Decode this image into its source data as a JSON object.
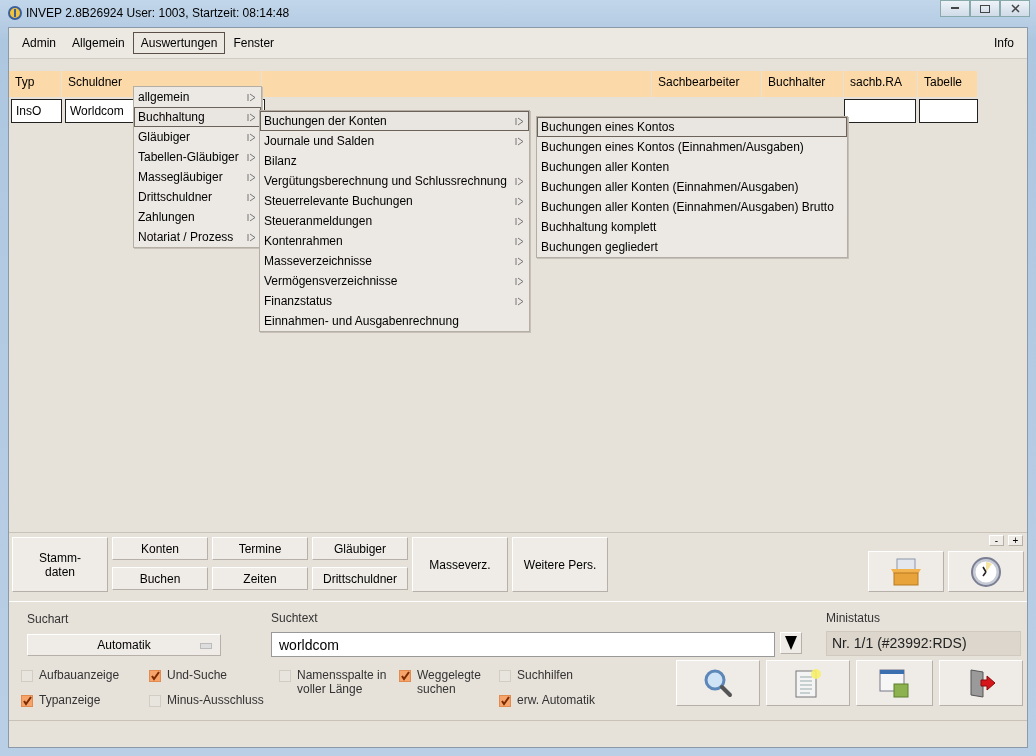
{
  "window": {
    "title": "INVEP 2.8B26924 User: 1003, Startzeit: 08:14:48"
  },
  "menubar": {
    "items": [
      {
        "label": "Admin",
        "selected": false
      },
      {
        "label": "Allgemein",
        "selected": false
      },
      {
        "label": "Auswertungen",
        "selected": true
      },
      {
        "label": "Fenster",
        "selected": false
      }
    ],
    "info": "Info"
  },
  "table": {
    "columns_left": [
      "Typ",
      "Schuldner"
    ],
    "columns_right": [
      "Sachbearbeiter",
      "Buchhalter",
      "sachb.RA",
      "Tabelle"
    ],
    "row": {
      "typ": "InsO",
      "schuldner": "Worldcom"
    }
  },
  "menus": [
    {
      "items": [
        {
          "label": "allgemein",
          "submenu": true,
          "selected": false
        },
        {
          "label": "Buchhaltung",
          "submenu": true,
          "selected": true
        },
        {
          "label": "Gläubiger",
          "submenu": true,
          "selected": false
        },
        {
          "label": "Tabellen-Gläubiger",
          "submenu": true,
          "selected": false
        },
        {
          "label": "Massegläubiger",
          "submenu": true,
          "selected": false
        },
        {
          "label": "Drittschuldner",
          "submenu": true,
          "selected": false
        },
        {
          "label": "Zahlungen",
          "submenu": true,
          "selected": false
        },
        {
          "label": "Notariat / Prozess",
          "submenu": true,
          "selected": false
        }
      ]
    },
    {
      "items": [
        {
          "label": "Buchungen der Konten",
          "submenu": true,
          "selected": true
        },
        {
          "label": "Journale und Salden",
          "submenu": true,
          "selected": false
        },
        {
          "label": "Bilanz",
          "submenu": false,
          "selected": false
        },
        {
          "label": "Vergütungsberechnung und Schlussrechnung",
          "submenu": true,
          "selected": false
        },
        {
          "label": "Steuerrelevante Buchungen",
          "submenu": true,
          "selected": false
        },
        {
          "label": "Steueranmeldungen",
          "submenu": true,
          "selected": false
        },
        {
          "label": "Kontenrahmen",
          "submenu": true,
          "selected": false
        },
        {
          "label": "Masseverzeichnisse",
          "submenu": true,
          "selected": false
        },
        {
          "label": "Vermögensverzeichnisse",
          "submenu": true,
          "selected": false
        },
        {
          "label": "Finanzstatus",
          "submenu": true,
          "selected": false
        },
        {
          "label": "Einnahmen- und Ausgabenrechnung",
          "submenu": false,
          "selected": false
        }
      ]
    },
    {
      "items": [
        {
          "label": "Buchungen eines Kontos",
          "submenu": false,
          "selected": true
        },
        {
          "label": "Buchungen eines Kontos (Einnahmen/Ausgaben)",
          "submenu": false,
          "selected": false
        },
        {
          "label": "Buchungen aller Konten",
          "submenu": false,
          "selected": false
        },
        {
          "label": "Buchungen aller Konten (Einnahmen/Ausgaben)",
          "submenu": false,
          "selected": false
        },
        {
          "label": "Buchungen aller Konten (Einnahmen/Ausgaben) Brutto",
          "submenu": false,
          "selected": false
        },
        {
          "label": "Buchhaltung komplett",
          "submenu": false,
          "selected": false
        },
        {
          "label": "Buchungen gegliedert",
          "submenu": false,
          "selected": false
        }
      ]
    }
  ],
  "nav_buttons": [
    {
      "label": "Stamm-\ndaten",
      "kind": "tall"
    },
    {
      "label": "Konten",
      "kind": "top"
    },
    {
      "label": "Buchen",
      "kind": "bottom"
    },
    {
      "label": "Termine",
      "kind": "top"
    },
    {
      "label": "Zeiten",
      "kind": "bottom"
    },
    {
      "label": "Gläubiger",
      "kind": "top"
    },
    {
      "label": "Drittschuldner",
      "kind": "bottom"
    },
    {
      "label": "Masseverz.",
      "kind": "tall"
    },
    {
      "label": "Weitere Pers.",
      "kind": "tall"
    }
  ],
  "zoom_buttons": [
    "-",
    "+"
  ],
  "search": {
    "suchart_label": "Suchart",
    "suchart_value": "Automatik",
    "suchtext_label": "Suchtext",
    "suchtext_value": "worldcom",
    "ministatus_label": "Ministatus",
    "ministatus_value": "Nr. 1/1 (#23992:RDS)"
  },
  "options": [
    [
      {
        "label": "Aufbauanzeige",
        "checked": false
      },
      {
        "label": "Typanzeige",
        "checked": true
      }
    ],
    [
      {
        "label": "Und-Suche",
        "checked": true
      },
      {
        "label": "Minus-Ausschluss",
        "checked": false
      }
    ],
    [
      {
        "label": "Namensspalte in voller Länge",
        "checked": false
      }
    ],
    [
      {
        "label": "Weggelegte suchen",
        "checked": true
      }
    ],
    [
      {
        "label": "Suchhilfen",
        "checked": false
      },
      {
        "label": "erw. Automatik",
        "checked": true
      }
    ]
  ]
}
